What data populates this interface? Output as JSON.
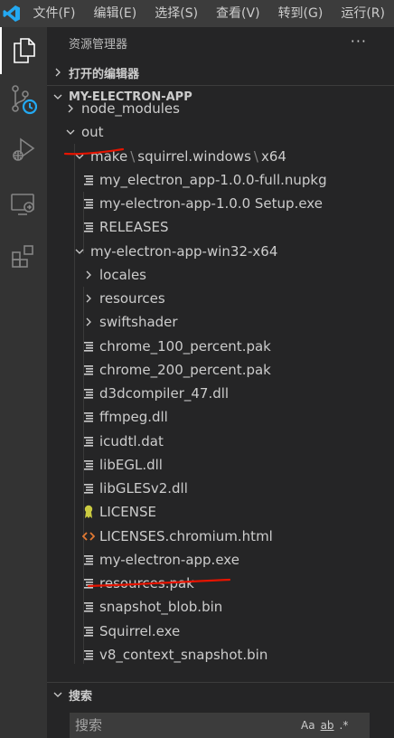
{
  "menubar": {
    "items": [
      "文件(F)",
      "编辑(E)",
      "选择(S)",
      "查看(V)",
      "转到(G)",
      "运行(R)"
    ]
  },
  "explorer": {
    "title": "资源管理器",
    "open_editors_label": "打开的编辑器",
    "project_label": "MY-ELECTRON-APP",
    "tree": [
      {
        "label": "node_modules",
        "kind": "folder-collapsed"
      },
      {
        "label": "out",
        "kind": "folder-expanded"
      },
      {
        "label_parts": [
          "make",
          "squirrel.windows",
          "x64"
        ],
        "kind": "folder-expanded"
      },
      {
        "label": "my_electron_app-1.0.0-full.nupkg",
        "kind": "file"
      },
      {
        "label": "my-electron-app-1.0.0 Setup.exe",
        "kind": "file"
      },
      {
        "label": "RELEASES",
        "kind": "file"
      },
      {
        "label": "my-electron-app-win32-x64",
        "kind": "folder-expanded"
      },
      {
        "label": "locales",
        "kind": "folder-collapsed"
      },
      {
        "label": "resources",
        "kind": "folder-collapsed"
      },
      {
        "label": "swiftshader",
        "kind": "folder-collapsed"
      },
      {
        "label": "chrome_100_percent.pak",
        "kind": "file"
      },
      {
        "label": "chrome_200_percent.pak",
        "kind": "file"
      },
      {
        "label": "d3dcompiler_47.dll",
        "kind": "file"
      },
      {
        "label": "ffmpeg.dll",
        "kind": "file"
      },
      {
        "label": "icudtl.dat",
        "kind": "file"
      },
      {
        "label": "libEGL.dll",
        "kind": "file"
      },
      {
        "label": "libGLESv2.dll",
        "kind": "file"
      },
      {
        "label": "LICENSE",
        "kind": "license"
      },
      {
        "label": "LICENSES.chromium.html",
        "kind": "html"
      },
      {
        "label": "my-electron-app.exe",
        "kind": "file"
      },
      {
        "label": "resources.pak",
        "kind": "file"
      },
      {
        "label": "snapshot_blob.bin",
        "kind": "file"
      },
      {
        "label": "Squirrel.exe",
        "kind": "file"
      },
      {
        "label": "v8_context_snapshot.bin",
        "kind": "file"
      }
    ]
  },
  "search": {
    "section_label": "搜索",
    "placeholder": "搜索",
    "options": [
      "Aa",
      "ab",
      ".*"
    ]
  },
  "colors": {
    "accent_blue": "#23a9f2",
    "license_yellow": "#cbcb41",
    "html_orange": "#e37933",
    "annotation_red": "#e51400"
  }
}
